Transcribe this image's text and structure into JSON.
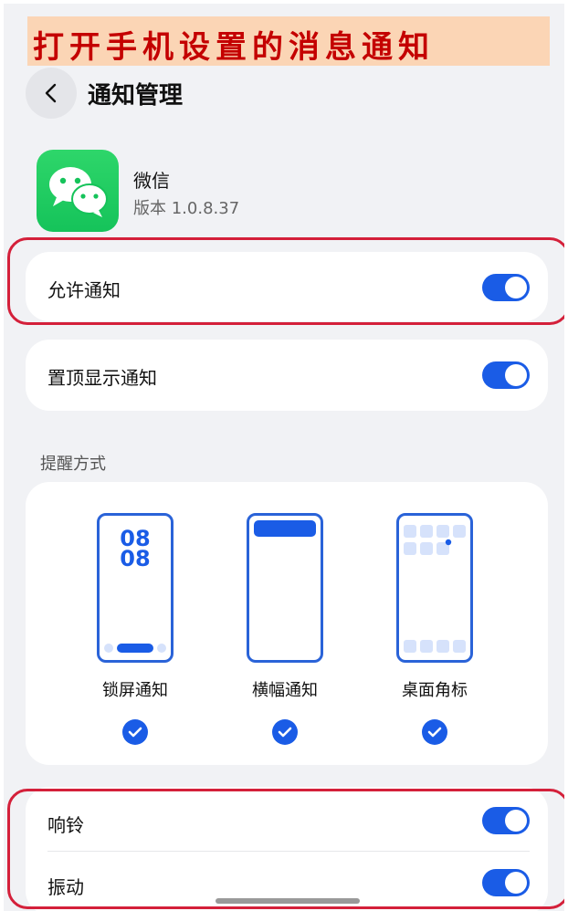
{
  "banner": {
    "text": "打开手机设置的消息通知"
  },
  "header": {
    "title": "通知管理",
    "back_icon": "chevron-left-icon"
  },
  "app": {
    "name": "微信",
    "version": "版本 1.0.8.37",
    "icon": "wechat-icon"
  },
  "settings": {
    "allow_notifications": {
      "label": "允许通知",
      "enabled": true
    },
    "pin_top": {
      "label": "置顶显示通知",
      "enabled": true
    }
  },
  "reminder": {
    "section_label": "提醒方式",
    "modes": [
      {
        "label": "锁屏通知",
        "checked": true,
        "clock_line1": "08",
        "clock_line2": "08"
      },
      {
        "label": "横幅通知",
        "checked": true
      },
      {
        "label": "桌面角标",
        "checked": true
      }
    ]
  },
  "sound": {
    "ringtone": {
      "label": "响铃",
      "enabled": true
    },
    "vibration": {
      "label": "振动",
      "enabled": true
    }
  },
  "colors": {
    "accent": "#1a5ce6",
    "highlight": "#d4203a",
    "banner_bg": "#fbd5b5",
    "banner_text": "#c40000"
  }
}
